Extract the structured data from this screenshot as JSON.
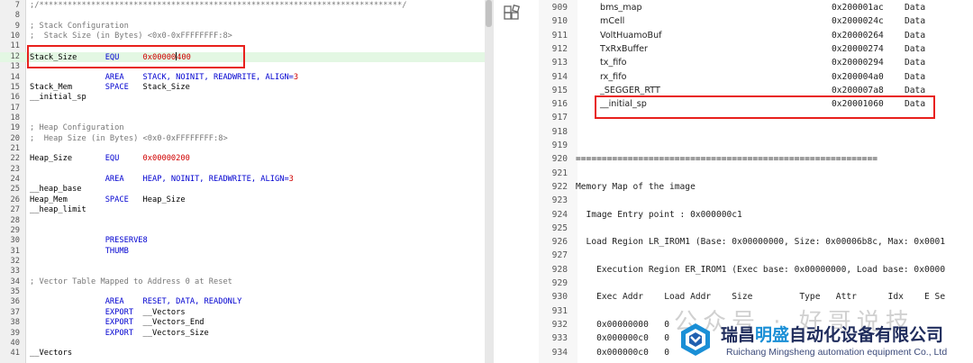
{
  "left_editor": {
    "lines": [
      {
        "n": "7",
        "html": "<span class='c'>;/*****************************************************************************/</span>"
      },
      {
        "n": "8",
        "html": ""
      },
      {
        "n": "9",
        "html": "<span class='c'>; Stack Configuration</span>"
      },
      {
        "n": "10",
        "html": "<span class='c'>;  Stack Size (in Bytes) &lt;0x0-0xFFFFFFFF:8&gt;</span>"
      },
      {
        "n": "11",
        "html": ""
      },
      {
        "n": "12",
        "html": "Stack_Size      <span class='k'>EQU</span>     <span class='n'>0x00000</span><span class='caret'></span><span class='n'>400</span>",
        "hl": true
      },
      {
        "n": "13",
        "html": ""
      },
      {
        "n": "14",
        "html": "                <span class='k'>AREA</span>    <span class='k'>STACK, NOINIT, READWRITE, ALIGN=</span><span class='n'>3</span>"
      },
      {
        "n": "15",
        "html": "Stack_Mem       <span class='k'>SPACE</span>   Stack_Size"
      },
      {
        "n": "16",
        "html": "__initial_sp"
      },
      {
        "n": "17",
        "html": ""
      },
      {
        "n": "18",
        "html": ""
      },
      {
        "n": "19",
        "html": "<span class='c'>; Heap Configuration</span>"
      },
      {
        "n": "20",
        "html": "<span class='c'>;  Heap Size (in Bytes) &lt;0x0-0xFFFFFFFF:8&gt;</span>"
      },
      {
        "n": "21",
        "html": ""
      },
      {
        "n": "22",
        "html": "Heap_Size       <span class='k'>EQU</span>     <span class='n'>0x00000200</span>"
      },
      {
        "n": "23",
        "html": ""
      },
      {
        "n": "24",
        "html": "                <span class='k'>AREA</span>    <span class='k'>HEAP, NOINIT, READWRITE, ALIGN=</span><span class='n'>3</span>"
      },
      {
        "n": "25",
        "html": "__heap_base"
      },
      {
        "n": "26",
        "html": "Heap_Mem        <span class='k'>SPACE</span>   Heap_Size"
      },
      {
        "n": "27",
        "html": "__heap_limit"
      },
      {
        "n": "28",
        "html": ""
      },
      {
        "n": "29",
        "html": ""
      },
      {
        "n": "30",
        "html": "                <span class='k'>PRESERVE8</span>"
      },
      {
        "n": "31",
        "html": "                <span class='k'>THUMB</span>"
      },
      {
        "n": "32",
        "html": ""
      },
      {
        "n": "33",
        "html": ""
      },
      {
        "n": "34",
        "html": "<span class='c'>; Vector Table Mapped to Address 0 at Reset</span>"
      },
      {
        "n": "35",
        "html": ""
      },
      {
        "n": "36",
        "html": "                <span class='k'>AREA</span>    <span class='k'>RESET, DATA, READONLY</span>"
      },
      {
        "n": "37",
        "html": "                <span class='k'>EXPORT</span>  __Vectors"
      },
      {
        "n": "38",
        "html": "                <span class='k'>EXPORT</span>  __Vectors_End"
      },
      {
        "n": "39",
        "html": "                <span class='k'>EXPORT</span>  __Vectors_Size"
      },
      {
        "n": "40",
        "html": ""
      },
      {
        "n": "41",
        "html": "__Vectors"
      }
    ]
  },
  "right_map": {
    "symbol_rows": [
      {
        "n": "909",
        "sym": "bms_map",
        "addr": "0x200001ac",
        "type": "Data"
      },
      {
        "n": "910",
        "sym": "mCell",
        "addr": "0x2000024c",
        "type": "Data"
      },
      {
        "n": "911",
        "sym": "VoltHuamoBuf",
        "addr": "0x20000264",
        "type": "Data"
      },
      {
        "n": "912",
        "sym": "TxRxBuffer",
        "addr": "0x20000274",
        "type": "Data"
      },
      {
        "n": "913",
        "sym": "tx_fifo",
        "addr": "0x20000294",
        "type": "Data"
      },
      {
        "n": "914",
        "sym": "rx_fifo",
        "addr": "0x200004a0",
        "type": "Data"
      },
      {
        "n": "915",
        "sym": "_SEGGER_RTT",
        "addr": "0x200007a8",
        "type": "Data"
      },
      {
        "n": "916",
        "sym": "__initial_sp",
        "addr": "0x20001060",
        "type": "Data"
      }
    ],
    "text_rows": [
      {
        "n": "917",
        "text": ""
      },
      {
        "n": "918",
        "text": ""
      },
      {
        "n": "919",
        "text": ""
      },
      {
        "n": "920",
        "text": "=========================================================="
      },
      {
        "n": "921",
        "text": ""
      },
      {
        "n": "922",
        "text": "Memory Map of the image"
      },
      {
        "n": "923",
        "text": ""
      },
      {
        "n": "924",
        "text": "  Image Entry point : 0x000000c1"
      },
      {
        "n": "925",
        "text": ""
      },
      {
        "n": "926",
        "text": "  Load Region LR_IROM1 (Base: 0x00000000, Size: 0x00006b8c, Max: 0x0001"
      },
      {
        "n": "927",
        "text": ""
      },
      {
        "n": "928",
        "text": "    Execution Region ER_IROM1 (Exec base: 0x00000000, Load base: 0x0000"
      },
      {
        "n": "929",
        "text": ""
      },
      {
        "n": "930",
        "text": "    Exec Addr    Load Addr    Size         Type   Attr      Idx    E Se"
      },
      {
        "n": "931",
        "text": ""
      },
      {
        "n": "932",
        "text": "    0x00000000   0"
      },
      {
        "n": "933",
        "text": "    0x000000c0   0"
      },
      {
        "n": "934",
        "text": "    0x000000c0   0"
      }
    ]
  },
  "watermark": {
    "ghost_text": "公众号 · 好哥说技",
    "name_cn_a": "瑞昌",
    "name_cn_hi": "明盛",
    "name_cn_b": "自动化设备有限公司",
    "name_en": "Ruichang Mingsheng automation equipment Co., Ltd"
  }
}
